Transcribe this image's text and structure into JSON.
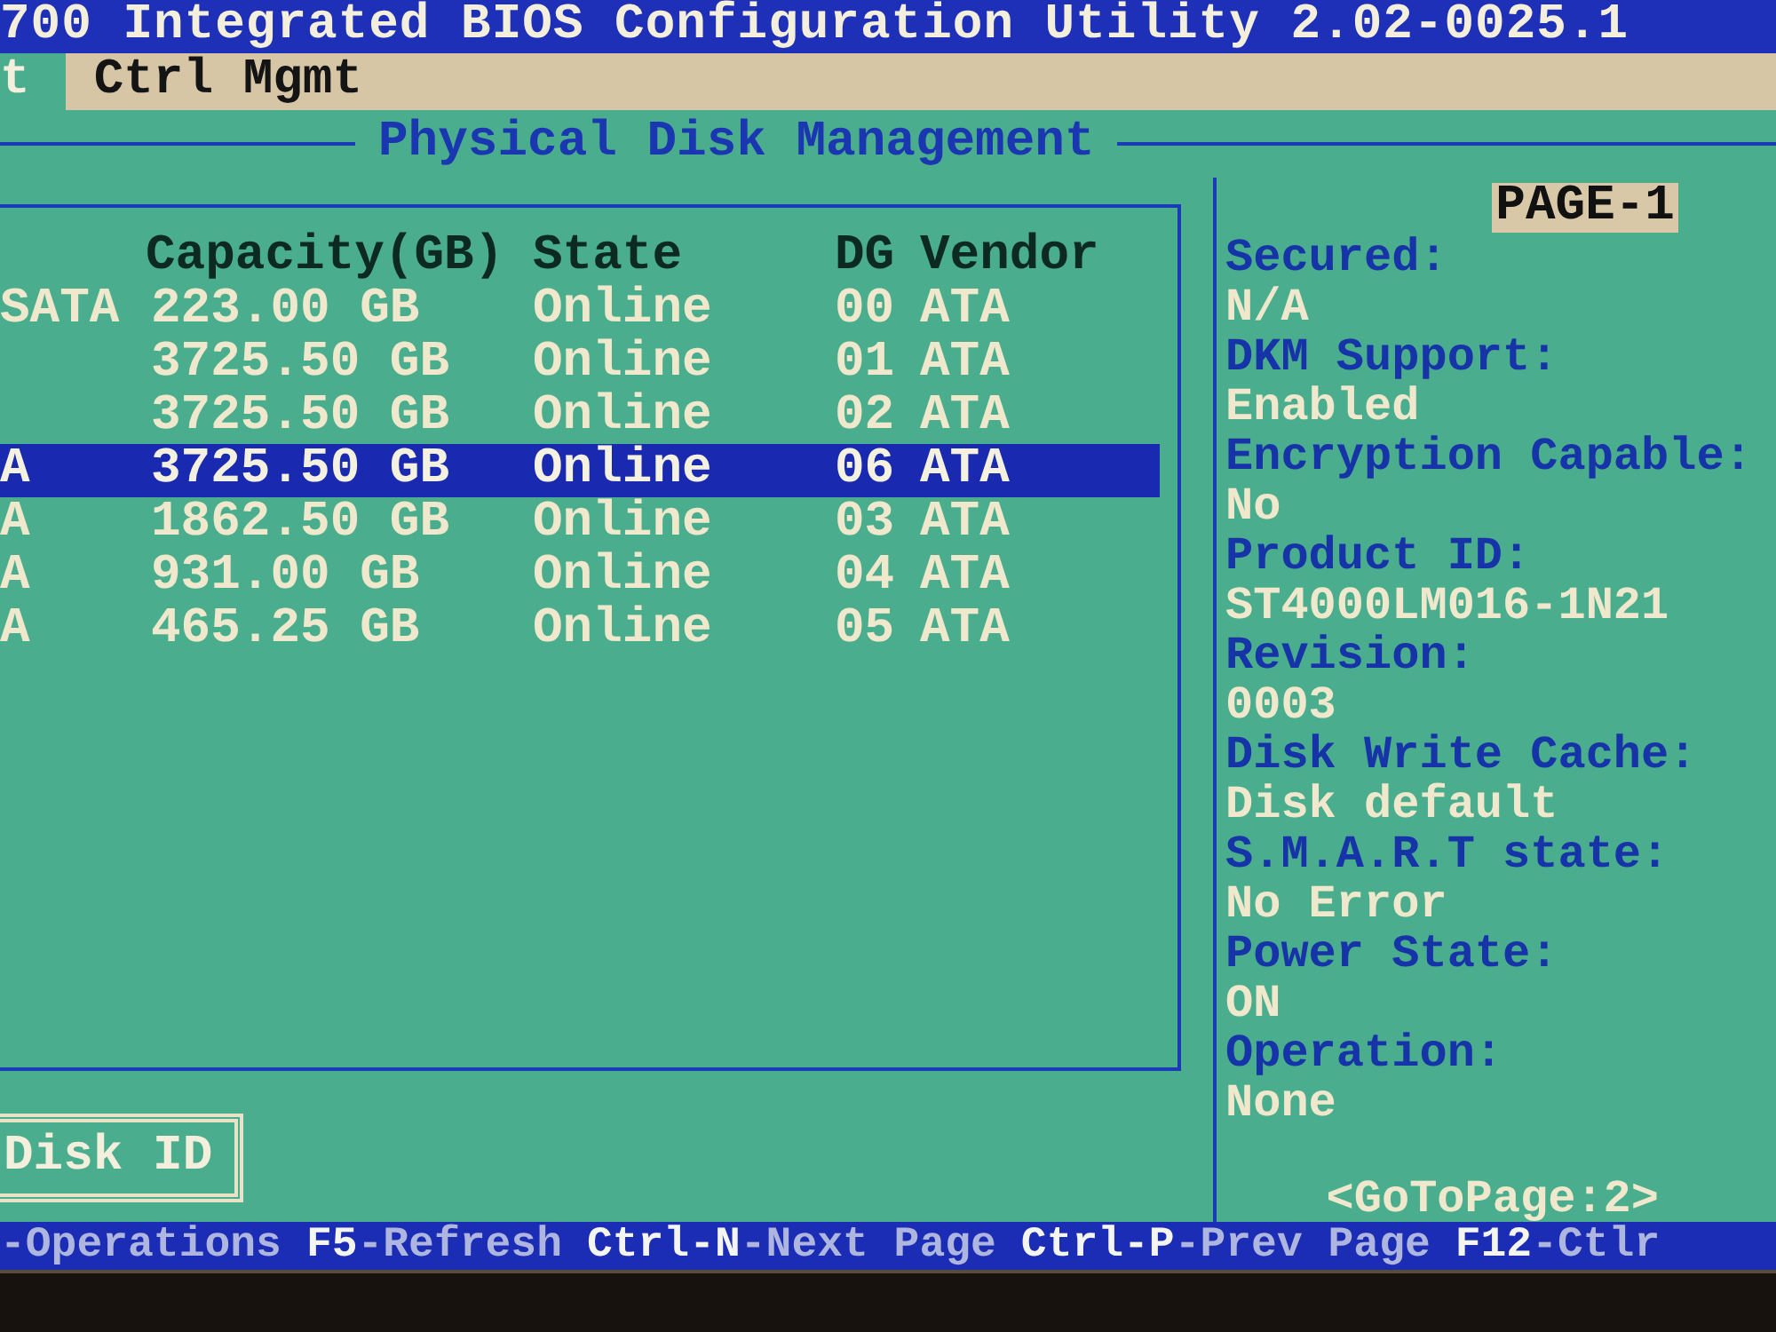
{
  "title_bar": {
    "title": "700 Integrated BIOS Configuration Utility 2.02-0025.1"
  },
  "tabs": [
    {
      "label": "t",
      "selected": true
    },
    {
      "label": "Ctrl Mgmt",
      "selected": false
    }
  ],
  "panel": {
    "title": "Physical Disk Management"
  },
  "table": {
    "columns": [
      "Capacity(GB)",
      "State",
      "DG",
      "Vendor"
    ],
    "rows": [
      {
        "column_1": "SATA",
        "capacity": "223.00 GB",
        "state": "Online",
        "dg": "00",
        "vendor": "ATA",
        "selected": false
      },
      {
        "capacity": "3725.50 GB",
        "state": "Online",
        "dg": "01",
        "vendor": "ATA",
        "selected": false
      },
      {
        "capacity": "3725.50 GB",
        "state": "Online",
        "dg": "02",
        "vendor": "ATA",
        "selected": false
      },
      {
        "column_1": "A",
        "capacity": "3725.50 GB",
        "state": "Online",
        "dg": "06",
        "vendor": "ATA",
        "selected": true
      },
      {
        "column_1": "A",
        "capacity": "1862.50 GB",
        "state": "Online",
        "dg": "03",
        "vendor": "ATA",
        "selected": false
      },
      {
        "column_1": "A",
        "capacity": "931.00 GB",
        "state": "Online",
        "dg": "04",
        "vendor": "ATA",
        "selected": false
      },
      {
        "column_1": "A",
        "capacity": "465.25 GB",
        "state": "Online",
        "dg": "05",
        "vendor": "ATA",
        "selected": false
      }
    ]
  },
  "disk_id_button": {
    "label": "Disk ID"
  },
  "details": {
    "page": "PAGE-1",
    "fields": [
      {
        "label": "Secured:",
        "value": "N/A"
      },
      {
        "label": "DKM Support:",
        "value": "Enabled"
      },
      {
        "label": "Encryption Capable:",
        "value": "No"
      },
      {
        "label": "Product ID:",
        "value": "ST4000LM016-1N21"
      },
      {
        "label": "Revision:",
        "value": "0003"
      },
      {
        "label": "Disk Write Cache:",
        "value": "Disk default"
      },
      {
        "label": "S.M.A.R.T state:",
        "value": "No Error"
      },
      {
        "label": "Power State:",
        "value": "ON"
      },
      {
        "label": "Operation:",
        "value": "None"
      }
    ],
    "goto": "<GoToPage:2>"
  },
  "status_bar": {
    "items": [
      {
        "action": "-Operations"
      },
      {
        "key": "F5",
        "action": "-Refresh"
      },
      {
        "key": "Ctrl-N",
        "action": "-Next Page"
      },
      {
        "key": "Ctrl-P",
        "action": "-Prev Page"
      },
      {
        "key": "F12",
        "action": "-Ctlr"
      }
    ]
  }
}
